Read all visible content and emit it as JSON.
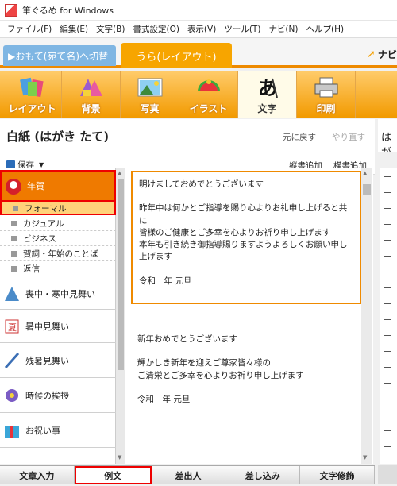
{
  "window": {
    "title": "筆ぐるめ for Windows"
  },
  "menu": [
    "ファイル(F)",
    "編集(E)",
    "文字(B)",
    "書式設定(O)",
    "表示(V)",
    "ツール(T)",
    "ナビ(N)",
    "ヘルプ(H)"
  ],
  "mode_tabs": {
    "omote": "▶おもて(宛て名)へ切替",
    "ura": "うら(レイアウト)",
    "navi": "ナビ"
  },
  "tools": [
    {
      "label": "レイアウト",
      "icon": "layout-icon"
    },
    {
      "label": "背景",
      "icon": "background-icon"
    },
    {
      "label": "写真",
      "icon": "photo-icon"
    },
    {
      "label": "イラスト",
      "icon": "illustration-icon"
    },
    {
      "label": "文字",
      "icon": "text-icon"
    },
    {
      "label": "印刷",
      "icon": "printer-icon"
    }
  ],
  "panel": {
    "title": "白紙 (はがき たて)",
    "undo": "元に戻す",
    "redo": "やり直す",
    "right_title": "はが"
  },
  "panel_tools": {
    "save": "保存",
    "tategaki": "縦書追加",
    "yokogaki": "横書追加"
  },
  "categories": [
    {
      "label": "年賀",
      "icon": "daruma-icon"
    },
    {
      "label": "喪中・寒中見舞い",
      "icon": "kanchu-icon"
    },
    {
      "label": "暑中見舞い",
      "icon": "fan-icon"
    },
    {
      "label": "残暑見舞い",
      "icon": "brush-icon"
    },
    {
      "label": "時候の挨拶",
      "icon": "flower-icon"
    },
    {
      "label": "お祝い事",
      "icon": "gift-icon"
    }
  ],
  "subcategories": [
    "フォーマル",
    "カジュアル",
    "ビジネス",
    "賀詞・年始のことば",
    "返信"
  ],
  "samples": [
    {
      "lines": [
        "明けましておめでとうございます",
        "",
        "昨年中は何かとご指導を賜り心よりお礼申し上げると共に",
        "皆様のご健康とご多幸を心よりお祈り申し上げます",
        "本年も引き続き御指導賜りますようよろしくお願い申し上げます",
        "",
        "令和　年 元旦"
      ]
    },
    {
      "lines": [
        "新年おめでとうございます",
        "",
        "輝かしき新年を迎えご尊家皆々様の",
        "ご清栄とご多幸を心よりお祈り申し上げます",
        "",
        "令和　年 元旦"
      ]
    }
  ],
  "bottom_tabs": [
    "文章入力",
    "例文",
    "差出人",
    "差し込み",
    "文字修飾"
  ]
}
